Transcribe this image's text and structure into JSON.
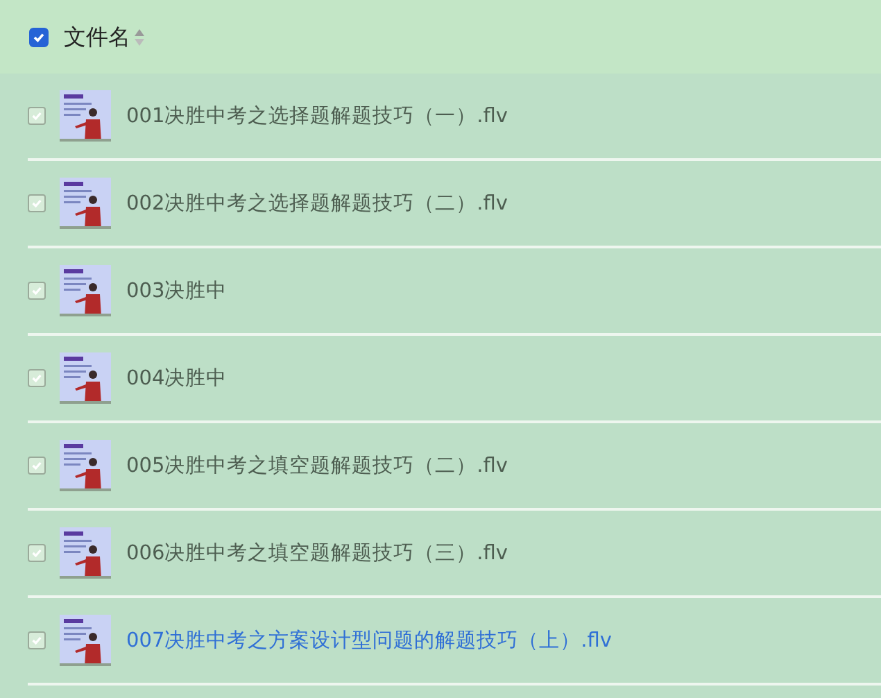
{
  "header": {
    "checked": true,
    "label": "文件名"
  },
  "rows": [
    {
      "name": "001决胜中考之选择题解题技巧（一）.flv",
      "checked": true,
      "selected": false
    },
    {
      "name": "002决胜中考之选择题解题技巧（二）.flv",
      "checked": true,
      "selected": false
    },
    {
      "name": "003决胜中",
      "checked": true,
      "selected": false
    },
    {
      "name": "004决胜中",
      "checked": true,
      "selected": false
    },
    {
      "name": "005决胜中考之填空题解题技巧（二）.flv",
      "checked": true,
      "selected": false
    },
    {
      "name": "006决胜中考之填空题解题技巧（三）.flv",
      "checked": true,
      "selected": false
    },
    {
      "name": "007决胜中考之方案设计型问题的解题技巧（上）.flv",
      "checked": true,
      "selected": true
    }
  ]
}
